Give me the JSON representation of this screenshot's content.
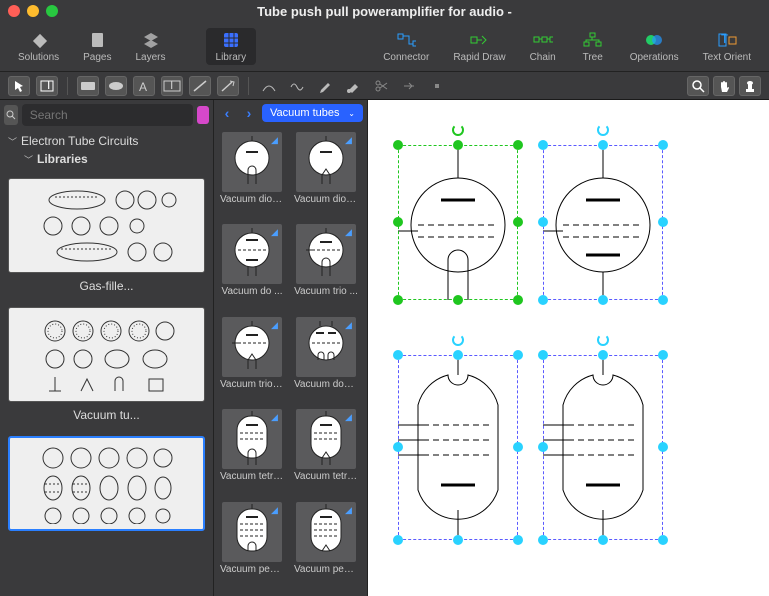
{
  "title": "Tube push pull poweramplifier for audio -",
  "toolbar": {
    "solutions": "Solutions",
    "pages": "Pages",
    "layers": "Layers",
    "library": "Library",
    "connector": "Connector",
    "rapid_draw": "Rapid Draw",
    "chain": "Chain",
    "tree": "Tree",
    "operations": "Operations",
    "text_orient": "Text Orient"
  },
  "search": {
    "placeholder": "Search"
  },
  "tree": {
    "root": "Electron Tube Circuits",
    "libraries": "Libraries"
  },
  "lib_cards": {
    "c1": "Gas-fille...",
    "c2": "Vacuum tu..."
  },
  "dropdown": {
    "selected": "Vacuum tubes"
  },
  "shapes": {
    "s1": "Vacuum diod ...",
    "s2": "Vacuum diod ...",
    "s3": "Vacuum do ...",
    "s4": "Vacuum trio ...",
    "s5": "Vacuum triod ...",
    "s6": "Vacuum dou ...",
    "s7": "Vacuum tetr ...",
    "s8": "Vacuum tetro ...",
    "s9": "Vacuum pent ...",
    "s10": "Vacuum pento ..."
  }
}
